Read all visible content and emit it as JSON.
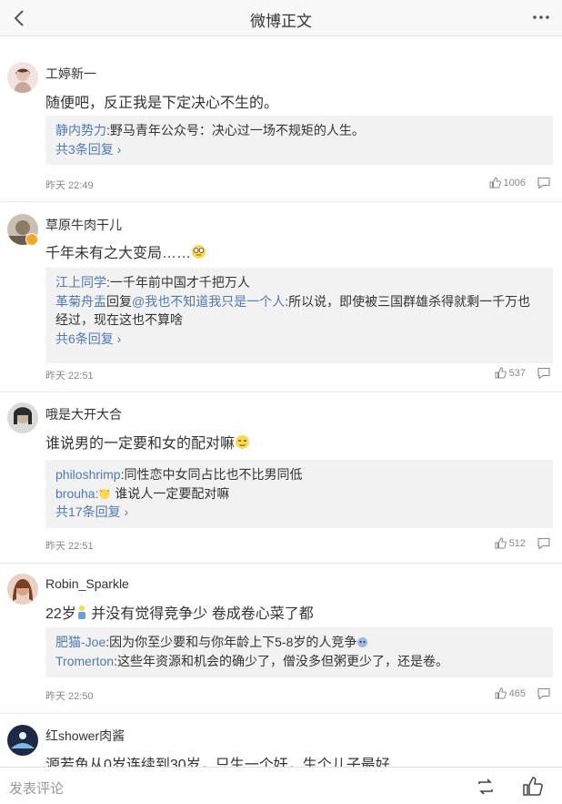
{
  "header": {
    "title": "微博正文"
  },
  "comments": [
    {
      "user": "工婷新一",
      "text": "随便吧，反正我是下定决心不生的。",
      "replies": [
        {
          "user": "静内势力",
          "text": ":野马青年公众号：决心过一场不规矩的人生。"
        }
      ],
      "more": "共3条回复",
      "time": "昨天 22:49",
      "likes": "1006"
    },
    {
      "user": "草原牛肉干儿",
      "text": "千年未有之大变局……",
      "replies": [
        {
          "user": "江上同学",
          "text": ":一千年前中国才千把万人"
        },
        {
          "user": "革菊舟盂",
          "mid": "回复",
          "mention": "@我也不知道我只是一个人",
          "text": ":所以说，即使被三国群雄杀得就剩一千万也经过，现在这也不算啥"
        }
      ],
      "more": "共6条回复",
      "time": "昨天 22:51",
      "likes": "537"
    },
    {
      "user": "哦是大开大合",
      "text": "谁说男的一定要和女的配对嘛",
      "replies": [
        {
          "user": "philoshrimp",
          "text": ":同性恋中女同占比也不比男同低"
        },
        {
          "user": "brouha",
          "text": " 谁说人一定要配对嘛"
        }
      ],
      "more": "共17条回复",
      "time": "昨天 22:51",
      "likes": "512"
    },
    {
      "user": "Robin_Sparkle",
      "text_a": "22岁",
      "text_b": " 并没有觉得竞争少 卷成卷心菜了都",
      "replies": [
        {
          "user": "肥猫-Joe",
          "text": ":因为你至少要和与你年龄上下5-8岁的人竞争"
        },
        {
          "user": "Tromerton",
          "text": ":这些年资源和机会的确少了，僧没多但粥更少了，还是卷。"
        }
      ],
      "time": "昨天 22:50",
      "likes": "465"
    },
    {
      "user": "红shower肉酱",
      "text": "源若鱼从0岁连续到30岁，只生一个奸，生个儿子最好"
    }
  ],
  "footer": {
    "placeholder": "发表评论"
  },
  "colors": {
    "link": "#5079b5",
    "badge": "#f5a623"
  }
}
